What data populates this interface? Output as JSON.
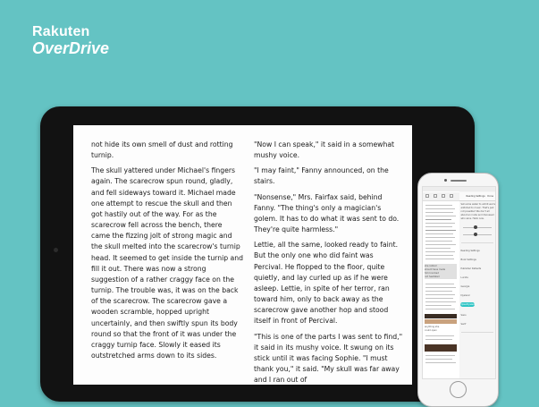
{
  "logo": {
    "line1": "Rakuten",
    "line2": "OverDrive"
  },
  "tablet": {
    "left_column": [
      "not hide its own smell of dust and rotting turnip.",
      "The skull yattered under Michael's fingers again. The scarecrow spun round, gladly, and fell sideways toward it. Michael made one attempt to rescue the skull and then got hastily out of the way. For as the scarecrow fell across the bench, there came the fizzing jolt of strong magic and the skull melted into the scarecrow's turnip head. It seemed to get inside the turnip and fill it out. There was now a strong suggestion of a rather craggy face on the turnip. The trouble was, it was on the back of the scarecrow. The scarecrow gave a wooden scramble, hopped upright uncertainly, and then swiftly spun its body round so that the front of it was under the craggy turnip face. Slowly it eased its outstretched arms down to its sides."
    ],
    "right_column": [
      "\"Now I can speak,\" it said in a somewhat mushy voice.",
      "\"I may faint,\" Fanny announced, on the stairs.",
      "\"Nonsense,\" Mrs. Fairfax said, behind Fanny. \"The thing's only a magician's golem. It has to do what it was sent to do. They're quite harmless.\"",
      "Lettie, all the same, looked ready to faint. But the only one who did faint was Percival. He flopped to the floor, quite quietly, and lay curled up as if he were asleep. Lettie, in spite of her terror, ran toward him, only to back away as the scarecrow gave another hop and stood itself in front of Percival.",
      "\"This is one of the parts I was sent to find,\" it said in its mushy voice. It swung on its stick until it was facing Sophie. \"I must thank you,\" it said. \"My skull was far away and I ran out of"
    ]
  },
  "phone": {
    "settings_title": "Reading Settings",
    "done_label": "Done",
    "right_lines": [
      "Set some water to admit we're",
      "addicted to music. That's just",
      "not possible? We don't all",
      "about en route and discussed",
      "who wins. Hallo now."
    ],
    "menu_items": [
      "Reading Settings",
      "Book Settings",
      "Publisher Defaults",
      "Lucida",
      "Georgia",
      "Dyslexic",
      "OpenDyslexic",
      "Sans",
      "Serif"
    ],
    "left_snippets": [
      "she retired",
      "should have made",
      "him knocked",
      "not hesitated",
      "anything she",
      "could open"
    ],
    "colors": {
      "accent": "#2ec4c4",
      "background": "#64c3c3"
    }
  }
}
